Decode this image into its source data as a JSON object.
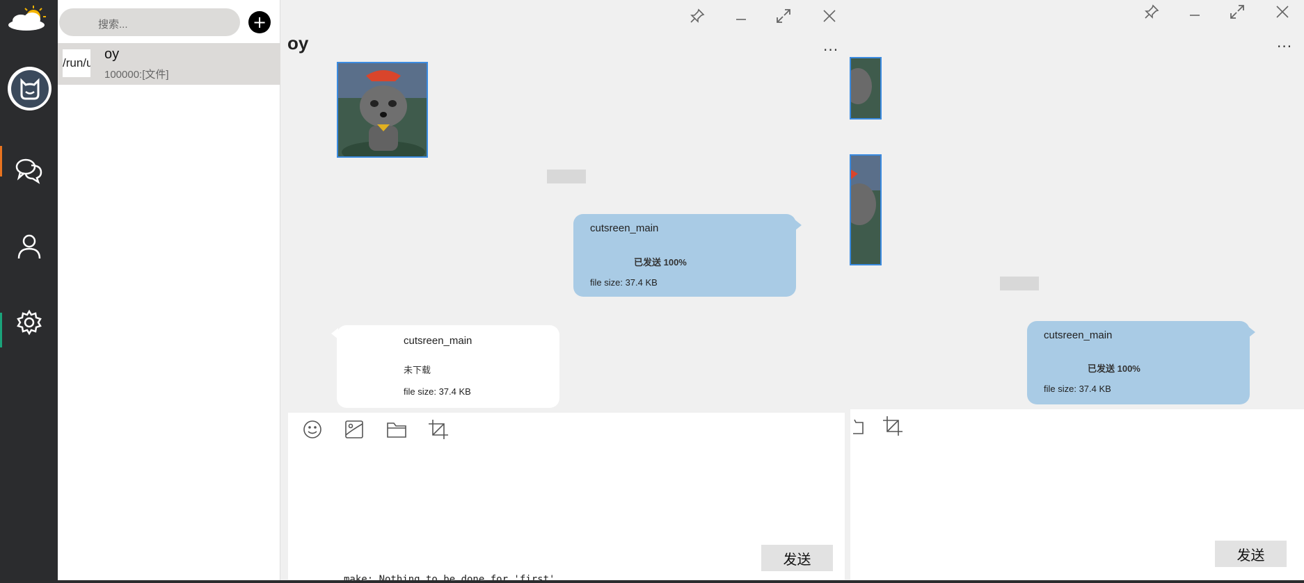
{
  "search": {
    "placeholder": "搜索..."
  },
  "add_button": {
    "label": "+"
  },
  "contact": {
    "thumb_text": "/run/u",
    "name": "oy",
    "last_message": "100000:[文件]"
  },
  "chat": {
    "title": "oy",
    "more_label": "...",
    "messages": [
      {
        "type": "file",
        "direction": "out",
        "file_name": "cutsreen_main",
        "status": "已发送 100%",
        "file_size": "file size: 37.4 KB"
      },
      {
        "type": "file",
        "direction": "in",
        "file_name": "cutsreen_main",
        "status": "未下载",
        "file_size": "file size: 37.4 KB"
      }
    ],
    "send_label": "发送"
  },
  "second_window": {
    "more_label": "...",
    "message": {
      "file_name": "cutsreen_main",
      "status": "已发送 100%",
      "file_size": "file size: 37.4 KB"
    },
    "send_label": "发送"
  },
  "terminal_text": "make: Nothing to be done for 'first'.",
  "colors": {
    "rail": "#2b2c2e",
    "bubble_out": "#a9cbe5",
    "bubble_in": "#ffffff",
    "selected_contact": "#dcdad8",
    "accent_orange": "#e8731f",
    "accent_green": "#1aa37a"
  }
}
